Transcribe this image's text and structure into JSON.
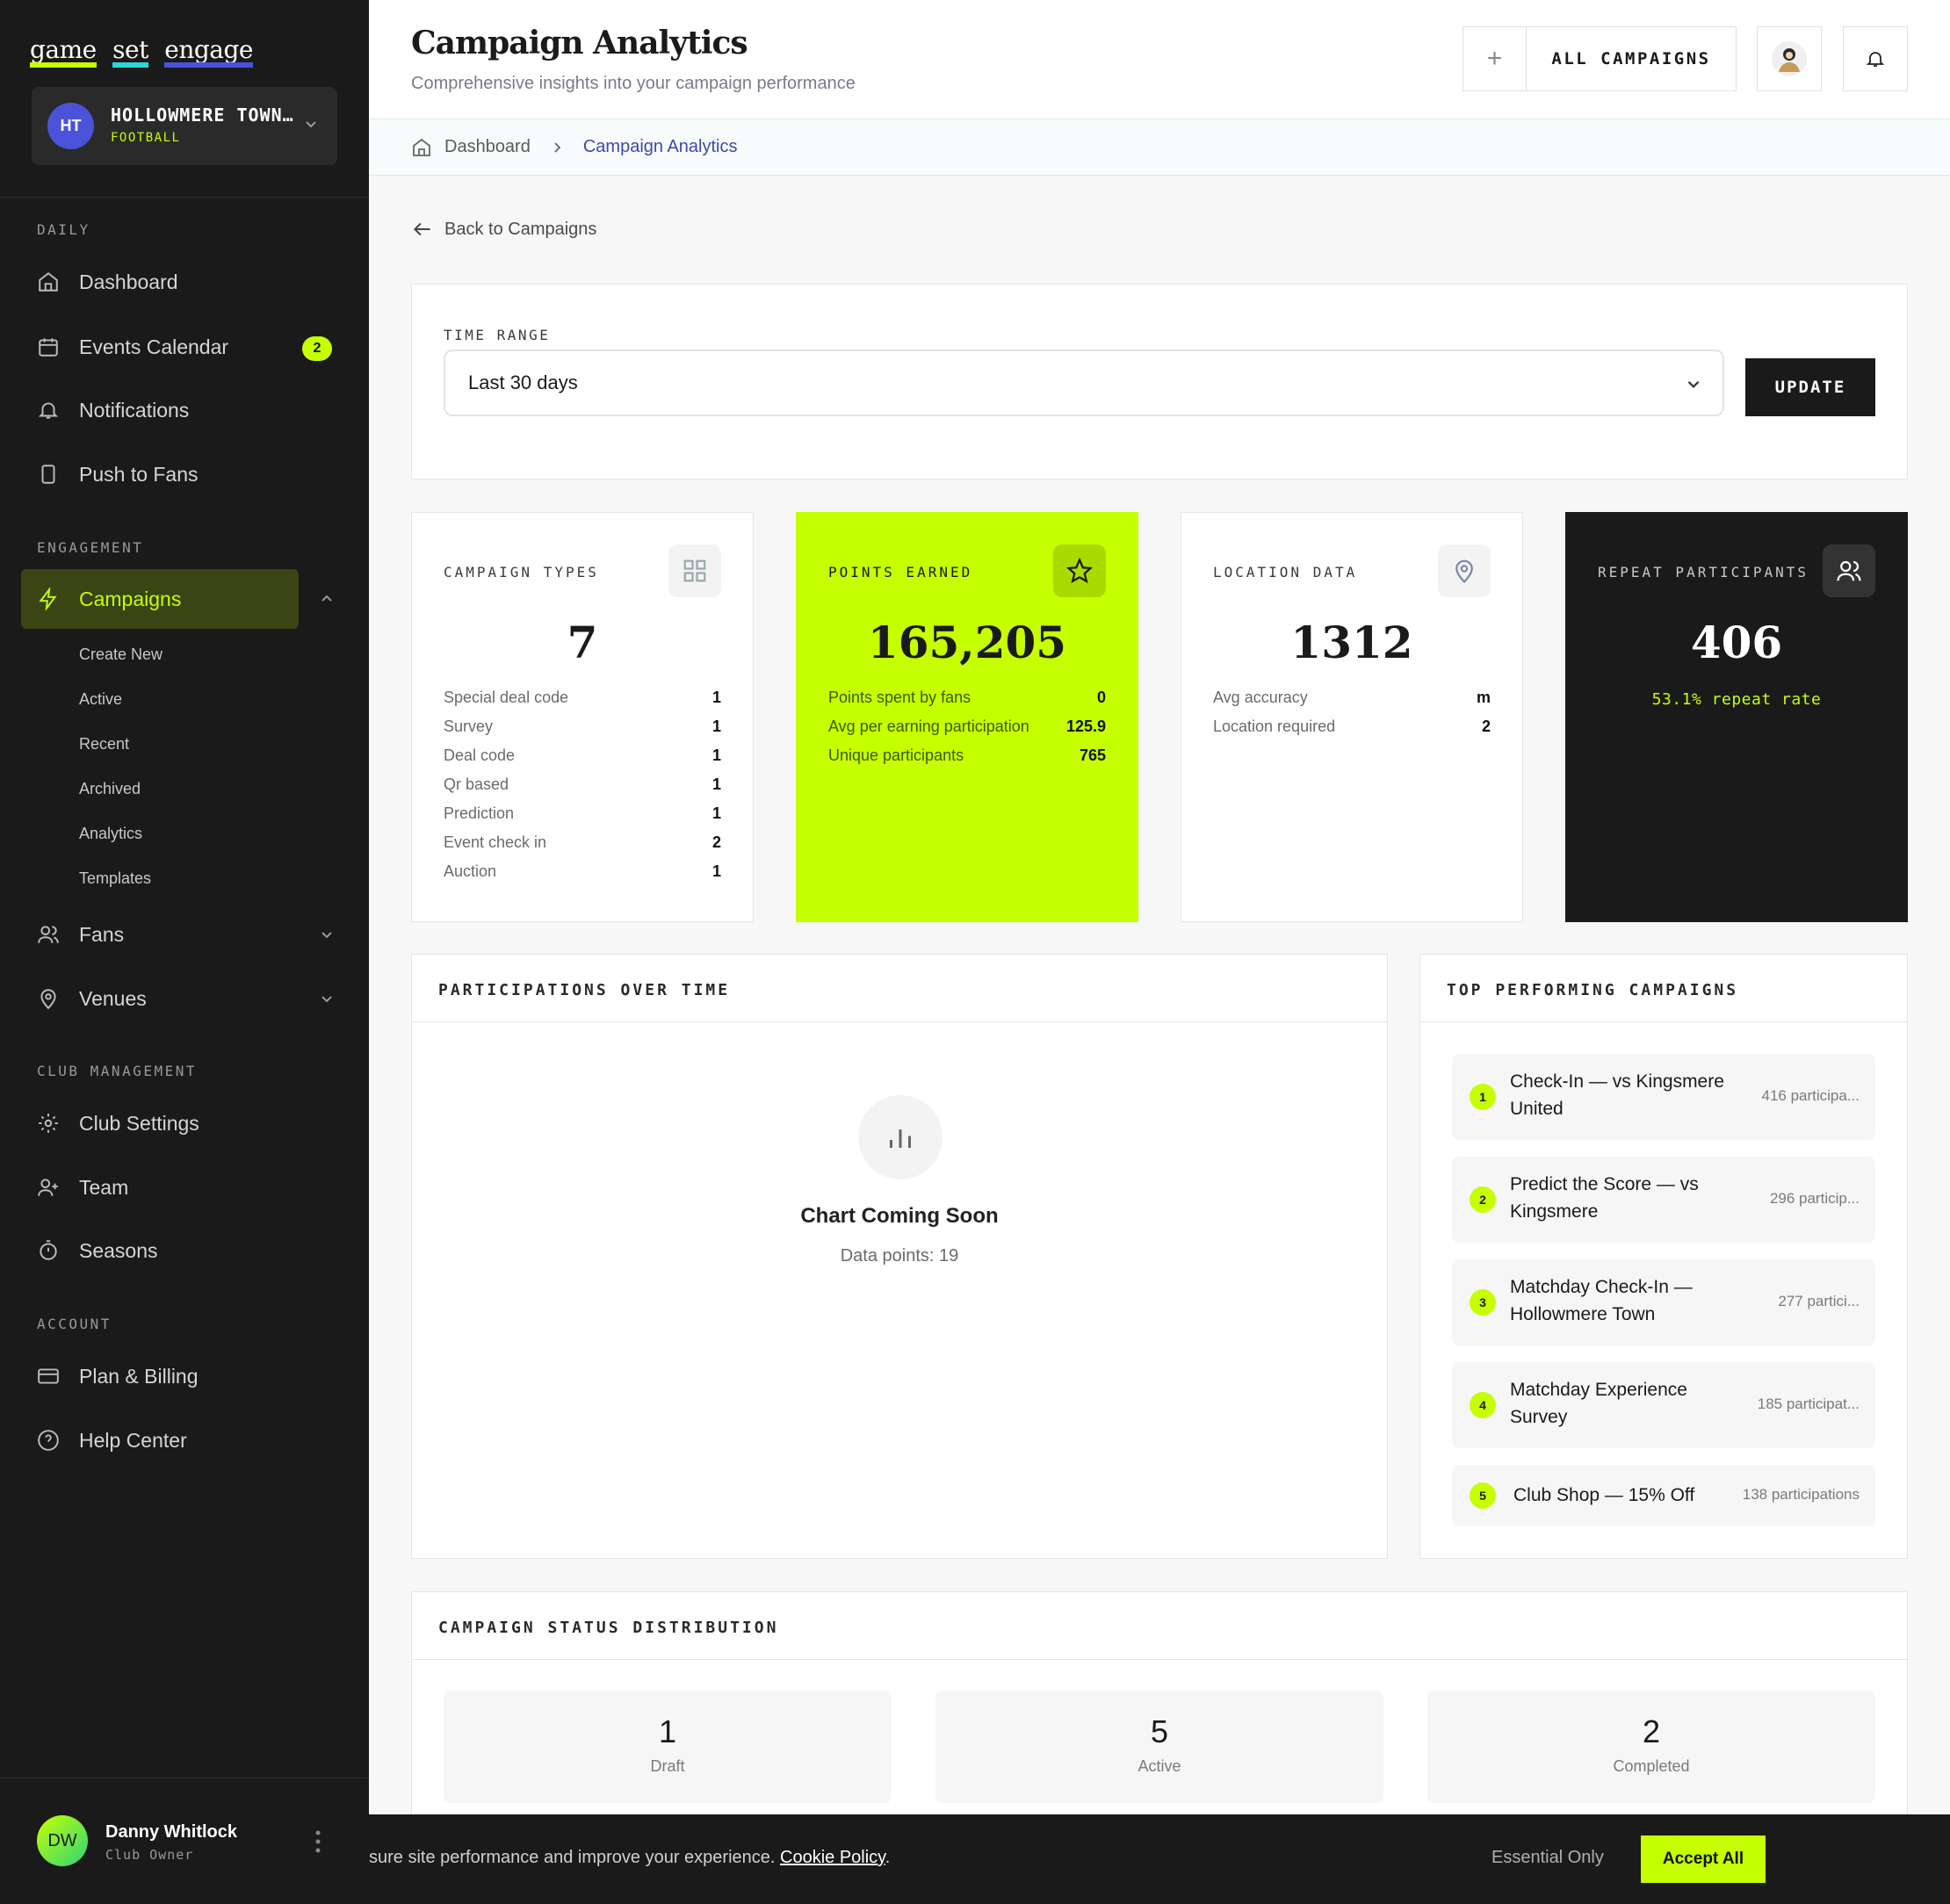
{
  "brand": {
    "words": [
      "game",
      "set",
      "engage"
    ],
    "colors": [
      "#c6ff00",
      "#2ed6d6",
      "#4a52d9"
    ]
  },
  "club": {
    "initials": "HT",
    "name": "HOLLOWMERE TOWN…",
    "sport": "FOOTBALL"
  },
  "sidebar": {
    "sections": {
      "daily": "DAILY",
      "engagement": "ENGAGEMENT",
      "club": "CLUB MANAGEMENT",
      "account": "ACCOUNT"
    },
    "items": {
      "dashboard": "Dashboard",
      "events": "Events Calendar",
      "events_badge": "2",
      "notifications": "Notifications",
      "push": "Push to Fans",
      "campaigns": "Campaigns",
      "fans": "Fans",
      "venues": "Venues",
      "club_settings": "Club Settings",
      "team": "Team",
      "seasons": "Seasons",
      "billing": "Plan & Billing",
      "help": "Help Center"
    },
    "sub": [
      "Create New",
      "Active",
      "Recent",
      "Archived",
      "Analytics",
      "Templates"
    ]
  },
  "user": {
    "initials": "DW",
    "name": "Danny Whitlock",
    "role": "Club Owner"
  },
  "header": {
    "title": "Campaign Analytics",
    "subtitle": "Comprehensive insights into your campaign performance",
    "all_campaigns": "ALL CAMPAIGNS"
  },
  "breadcrumb": {
    "home": "Dashboard",
    "current": "Campaign Analytics"
  },
  "back": "Back to Campaigns",
  "range": {
    "label": "TIME RANGE",
    "value": "Last 30 days",
    "update": "UPDATE"
  },
  "stats": {
    "types": {
      "title": "CAMPAIGN TYPES",
      "value": "7",
      "rows": [
        {
          "label": "Special deal code",
          "value": "1"
        },
        {
          "label": "Survey",
          "value": "1"
        },
        {
          "label": "Deal code",
          "value": "1"
        },
        {
          "label": "Qr based",
          "value": "1"
        },
        {
          "label": "Prediction",
          "value": "1"
        },
        {
          "label": "Event check in",
          "value": "2"
        },
        {
          "label": "Auction",
          "value": "1"
        }
      ]
    },
    "points": {
      "title": "POINTS EARNED",
      "value": "165,205",
      "rows": [
        {
          "label": "Points spent by fans",
          "value": "0"
        },
        {
          "label": "Avg per earning participation",
          "value": "125.9"
        },
        {
          "label": "Unique participants",
          "value": "765"
        }
      ]
    },
    "location": {
      "title": "LOCATION DATA",
      "value": "1312",
      "rows": [
        {
          "label": "Avg accuracy",
          "value": "m"
        },
        {
          "label": "Location required",
          "value": "2"
        }
      ]
    },
    "repeat": {
      "title": "REPEAT PARTICIPANTS",
      "value": "406",
      "rate": "53.1% repeat rate"
    }
  },
  "participations": {
    "title": "PARTICIPATIONS OVER TIME",
    "placeholder": "Chart Coming Soon",
    "data_points": "Data points: 19"
  },
  "top": {
    "title": "TOP PERFORMING CAMPAIGNS",
    "items": [
      {
        "rank": "1",
        "name": "Check-In — vs Kingsmere United",
        "count": "416 participa..."
      },
      {
        "rank": "2",
        "name": "Predict the Score — vs Kingsmere",
        "count": "296 particip..."
      },
      {
        "rank": "3",
        "name": "Matchday Check-In — Hollowmere Town",
        "count": "277 partici..."
      },
      {
        "rank": "4",
        "name": "Matchday Experience Survey",
        "count": "185 participat..."
      },
      {
        "rank": "5",
        "name": "Club Shop — 15% Off",
        "count": "138 participations"
      }
    ]
  },
  "status": {
    "title": "CAMPAIGN STATUS DISTRIBUTION",
    "items": [
      {
        "value": "1",
        "label": "Draft"
      },
      {
        "value": "5",
        "label": "Active"
      },
      {
        "value": "2",
        "label": "Completed"
      }
    ]
  },
  "cookie": {
    "text": "sure site performance and improve your experience.",
    "link": "Cookie Policy",
    "period": ".",
    "essential": "Essential Only",
    "accept": "Accept All"
  }
}
